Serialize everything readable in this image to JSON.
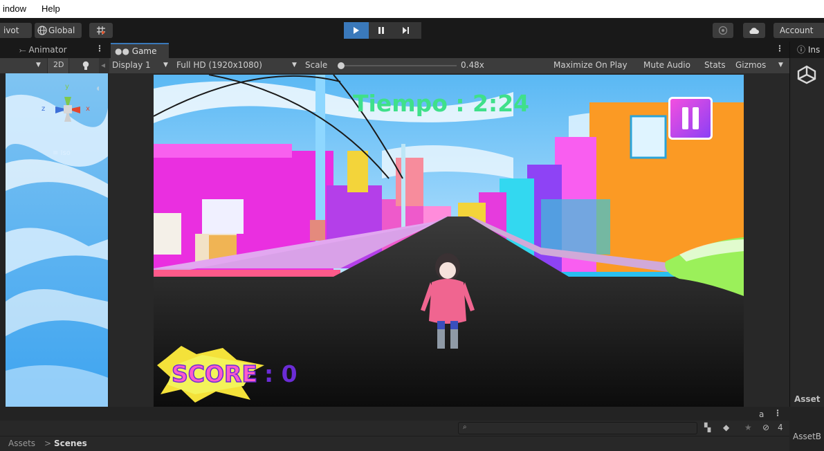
{
  "menu": {
    "window_label": "indow",
    "help_label": "Help"
  },
  "toolbar": {
    "pivot_label": "ivot",
    "global_label": "Global",
    "account_label": "Account"
  },
  "scene_panel": {
    "animator_tab": "Animator",
    "mode_2d": "2D",
    "gizmo_y": "y",
    "gizmo_x": "x",
    "gizmo_z": "z",
    "persp_label": "≡ Iso"
  },
  "game_panel": {
    "tab_label": "Game",
    "display_label": "Display 1",
    "resolution_label": "Full HD (1920x1080)",
    "scale_label": "Scale",
    "scale_value": "0.48x",
    "maximize_label": "Maximize On Play",
    "mute_label": "Mute Audio",
    "stats_label": "Stats",
    "gizmos_label": "Gizmos"
  },
  "game_hud": {
    "timer_text": "Tiempo : 2:24",
    "score_word": "SCORE",
    "score_value": ": 0"
  },
  "inspector": {
    "tab_label": "Ins",
    "asset_label_1": "Asset",
    "asset_label_2": "AssetB"
  },
  "project": {
    "breadcrumb_root": "Assets",
    "breadcrumb_sep": ">",
    "breadcrumb_leaf": "Scenes",
    "hidden_count": "4",
    "lock_glyph": "a"
  },
  "colors": {
    "accent_blue": "#3a79bb",
    "timer_green": "#3fe08a",
    "score_purple": "#6b2cd6"
  }
}
